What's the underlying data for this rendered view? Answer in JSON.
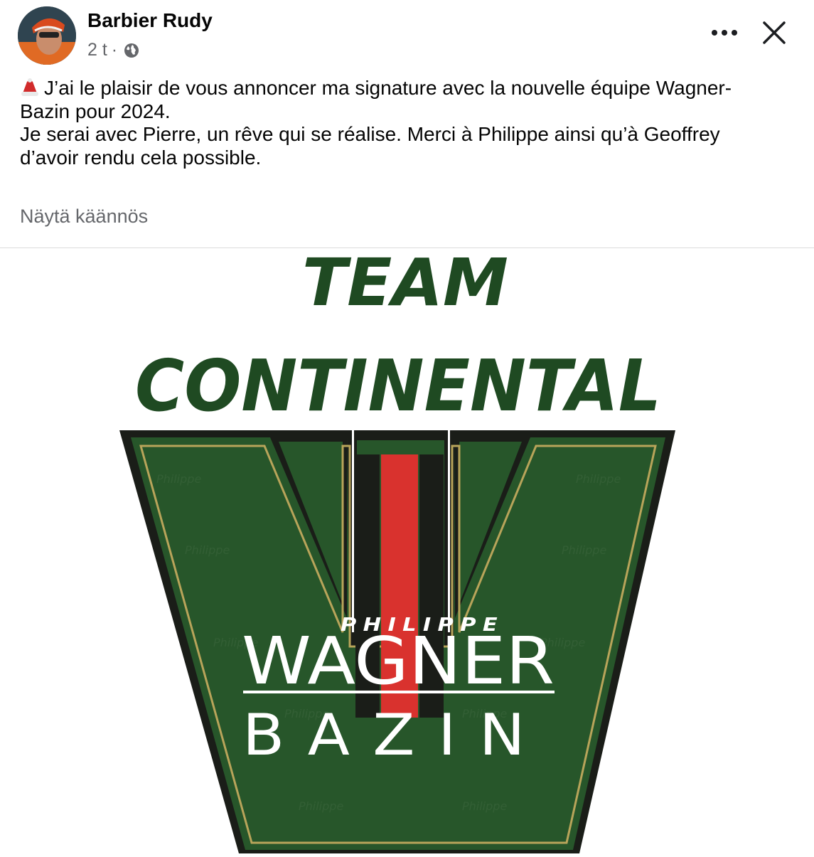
{
  "post": {
    "author": "Barbier Rudy",
    "time": "2 t",
    "separator": "·",
    "audience_icon": "globe-icon",
    "lines": [
      "J’ai le plaisir de vous annoncer ma signature avec la nouvelle équipe Wagner-",
      "Bazin pour 2024.",
      "Je serai avec Pierre, un rêve qui se réalise. Merci à Philippe ainsi qu’à Geoffrey",
      "d’avoir rendu cela possible."
    ],
    "leading_emoji": "santa-hat-emoji",
    "translate_link": "Näytä käännös"
  },
  "actions": {
    "more_icon": "more-options-icon",
    "close_icon": "close-icon"
  },
  "image": {
    "line1": "TEAM",
    "line2": "CONTINENTAL",
    "brand_small": "PHILIPPE",
    "brand_big": "WAGNER",
    "brand_bottom": "BAZIN",
    "watermark": "Philippe",
    "colors": {
      "dark_green": "#1f4a22",
      "logo_green": "#27562a",
      "gold": "#b8a45a",
      "red": "#d9322e",
      "black": "#1a1d18"
    }
  }
}
